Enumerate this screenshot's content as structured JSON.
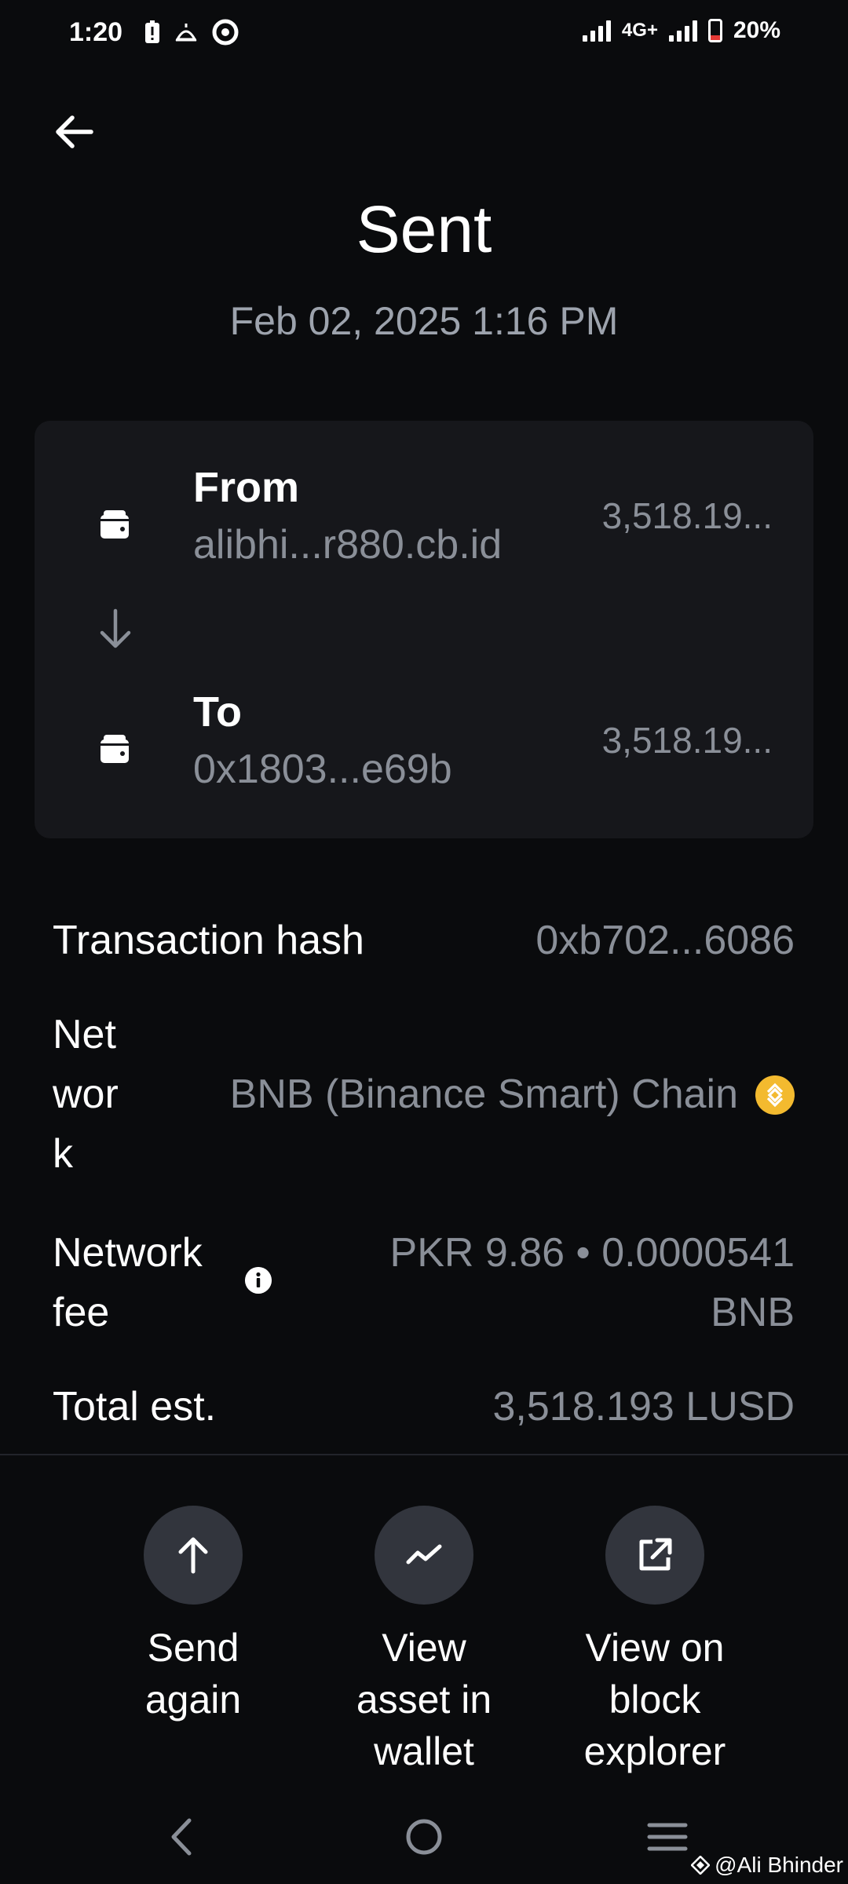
{
  "status_bar": {
    "time": "1:20",
    "network": "4G+",
    "battery": "20%"
  },
  "header": {
    "title": "Sent",
    "date": "Feb 02, 2025 1:16 PM"
  },
  "transfer": {
    "from": {
      "label": "From",
      "address": "alibhi...r880.cb.id",
      "amount": "3,518.19..."
    },
    "to": {
      "label": "To",
      "address": "0x1803...e69b",
      "amount": "3,518.19..."
    }
  },
  "details": {
    "hash": {
      "label": "Transaction hash",
      "value": "0xb702...6086"
    },
    "network": {
      "label_lines": [
        "Net",
        "wor",
        "k"
      ],
      "value": "BNB (Binance Smart) Chain"
    },
    "fee": {
      "label_lines": [
        "Network",
        "fee"
      ],
      "value_lines": [
        "PKR 9.86 • 0.0000541",
        "BNB"
      ]
    },
    "total": {
      "label": "Total est.",
      "value": "3,518.193 LUSD"
    }
  },
  "actions": [
    {
      "label_lines": [
        "Send",
        "again"
      ],
      "icon": "arrow-up-icon"
    },
    {
      "label_lines": [
        "View",
        "asset in",
        "wallet"
      ],
      "icon": "trend-icon"
    },
    {
      "label_lines": [
        "View on",
        "block",
        "explorer"
      ],
      "icon": "external-link-icon"
    }
  ],
  "watermark": "@Ali Bhinder",
  "colors": {
    "background": "#0a0b0d",
    "card": "#16171b",
    "muted_text": "#8a8f98",
    "bnb": "#f3ba2f",
    "action_circle": "#32353d"
  }
}
